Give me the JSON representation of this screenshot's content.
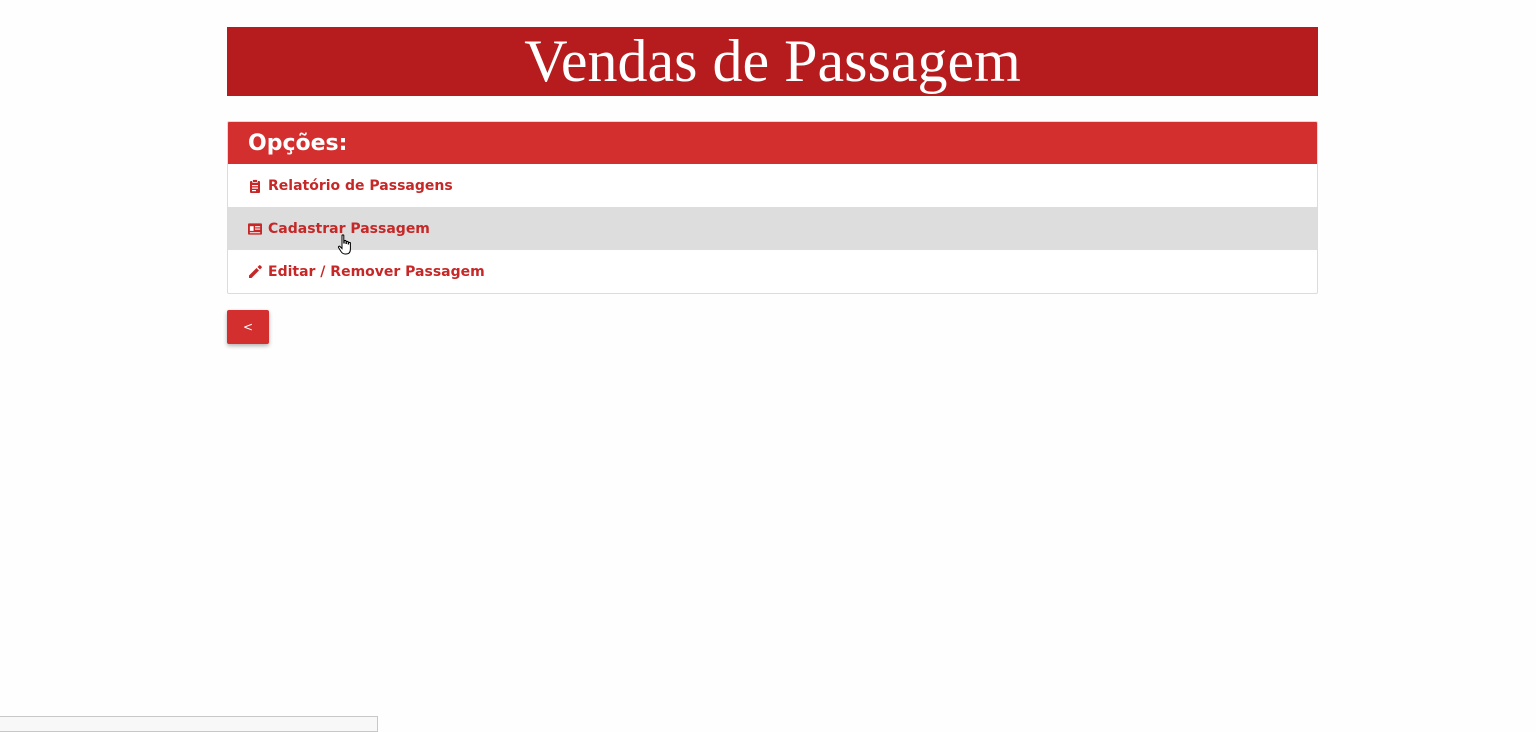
{
  "header": {
    "title": "Vendas de Passagem"
  },
  "options_panel": {
    "title": "Opções:",
    "items": [
      {
        "label": "Relatório de Passagens",
        "icon": "clipboard-icon"
      },
      {
        "label": "Cadastrar Passagem",
        "icon": "id-card-icon"
      },
      {
        "label": "Editar / Remover Passagem",
        "icon": "pencil-icon"
      }
    ]
  },
  "back_button": {
    "label": "<"
  },
  "colors": {
    "banner": "#b61c1e",
    "accent": "#d32f2f",
    "link": "#c62828",
    "hover": "#dddddd"
  }
}
